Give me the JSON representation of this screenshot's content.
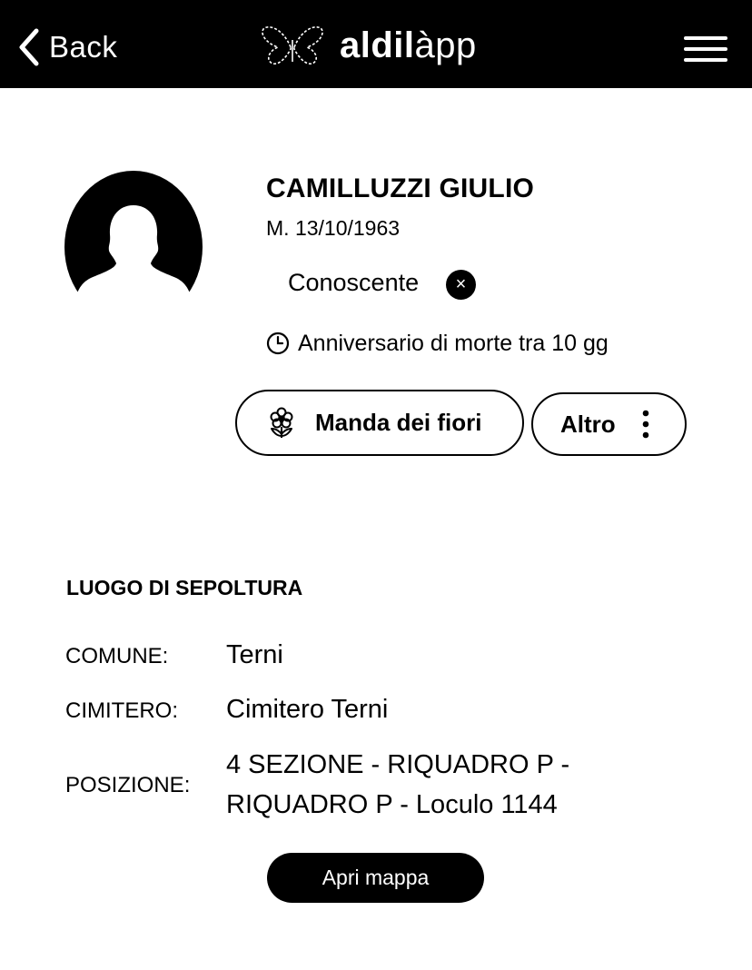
{
  "header": {
    "back_label": "Back",
    "logo_text_bold": "aldil",
    "logo_text_light": "àpp"
  },
  "profile": {
    "name": "CAMILLUZZI GIULIO",
    "birth": "M. 13/10/1963",
    "relation": "Conoscente",
    "relation_remove": "×",
    "anniversary": "Anniversario di morte tra 10 gg"
  },
  "actions": {
    "flowers_label": "Manda dei fiori",
    "more_label": "Altro"
  },
  "burial": {
    "title": "LUOGO DI SEPOLTURA",
    "rows": [
      {
        "label": "COMUNE:",
        "value": "Terni"
      },
      {
        "label": "CIMITERO:",
        "value": "Cimitero Terni"
      },
      {
        "label": "POSIZIONE:",
        "value": "4 SEZIONE - RIQUADRO P - RIQUADRO P - Loculo 1144"
      }
    ],
    "map_button": "Apri mappa"
  },
  "icons": {
    "back": "chevron-left-icon",
    "logo": "butterfly-icon",
    "menu": "hamburger-icon",
    "avatar": "person-silhouette-icon",
    "remove": "close-icon",
    "clock": "clock-icon",
    "flower": "flower-icon",
    "more": "vertical-dots-icon"
  },
  "colors": {
    "header_bg": "#000000",
    "background": "#ffffff",
    "text": "#000000"
  }
}
